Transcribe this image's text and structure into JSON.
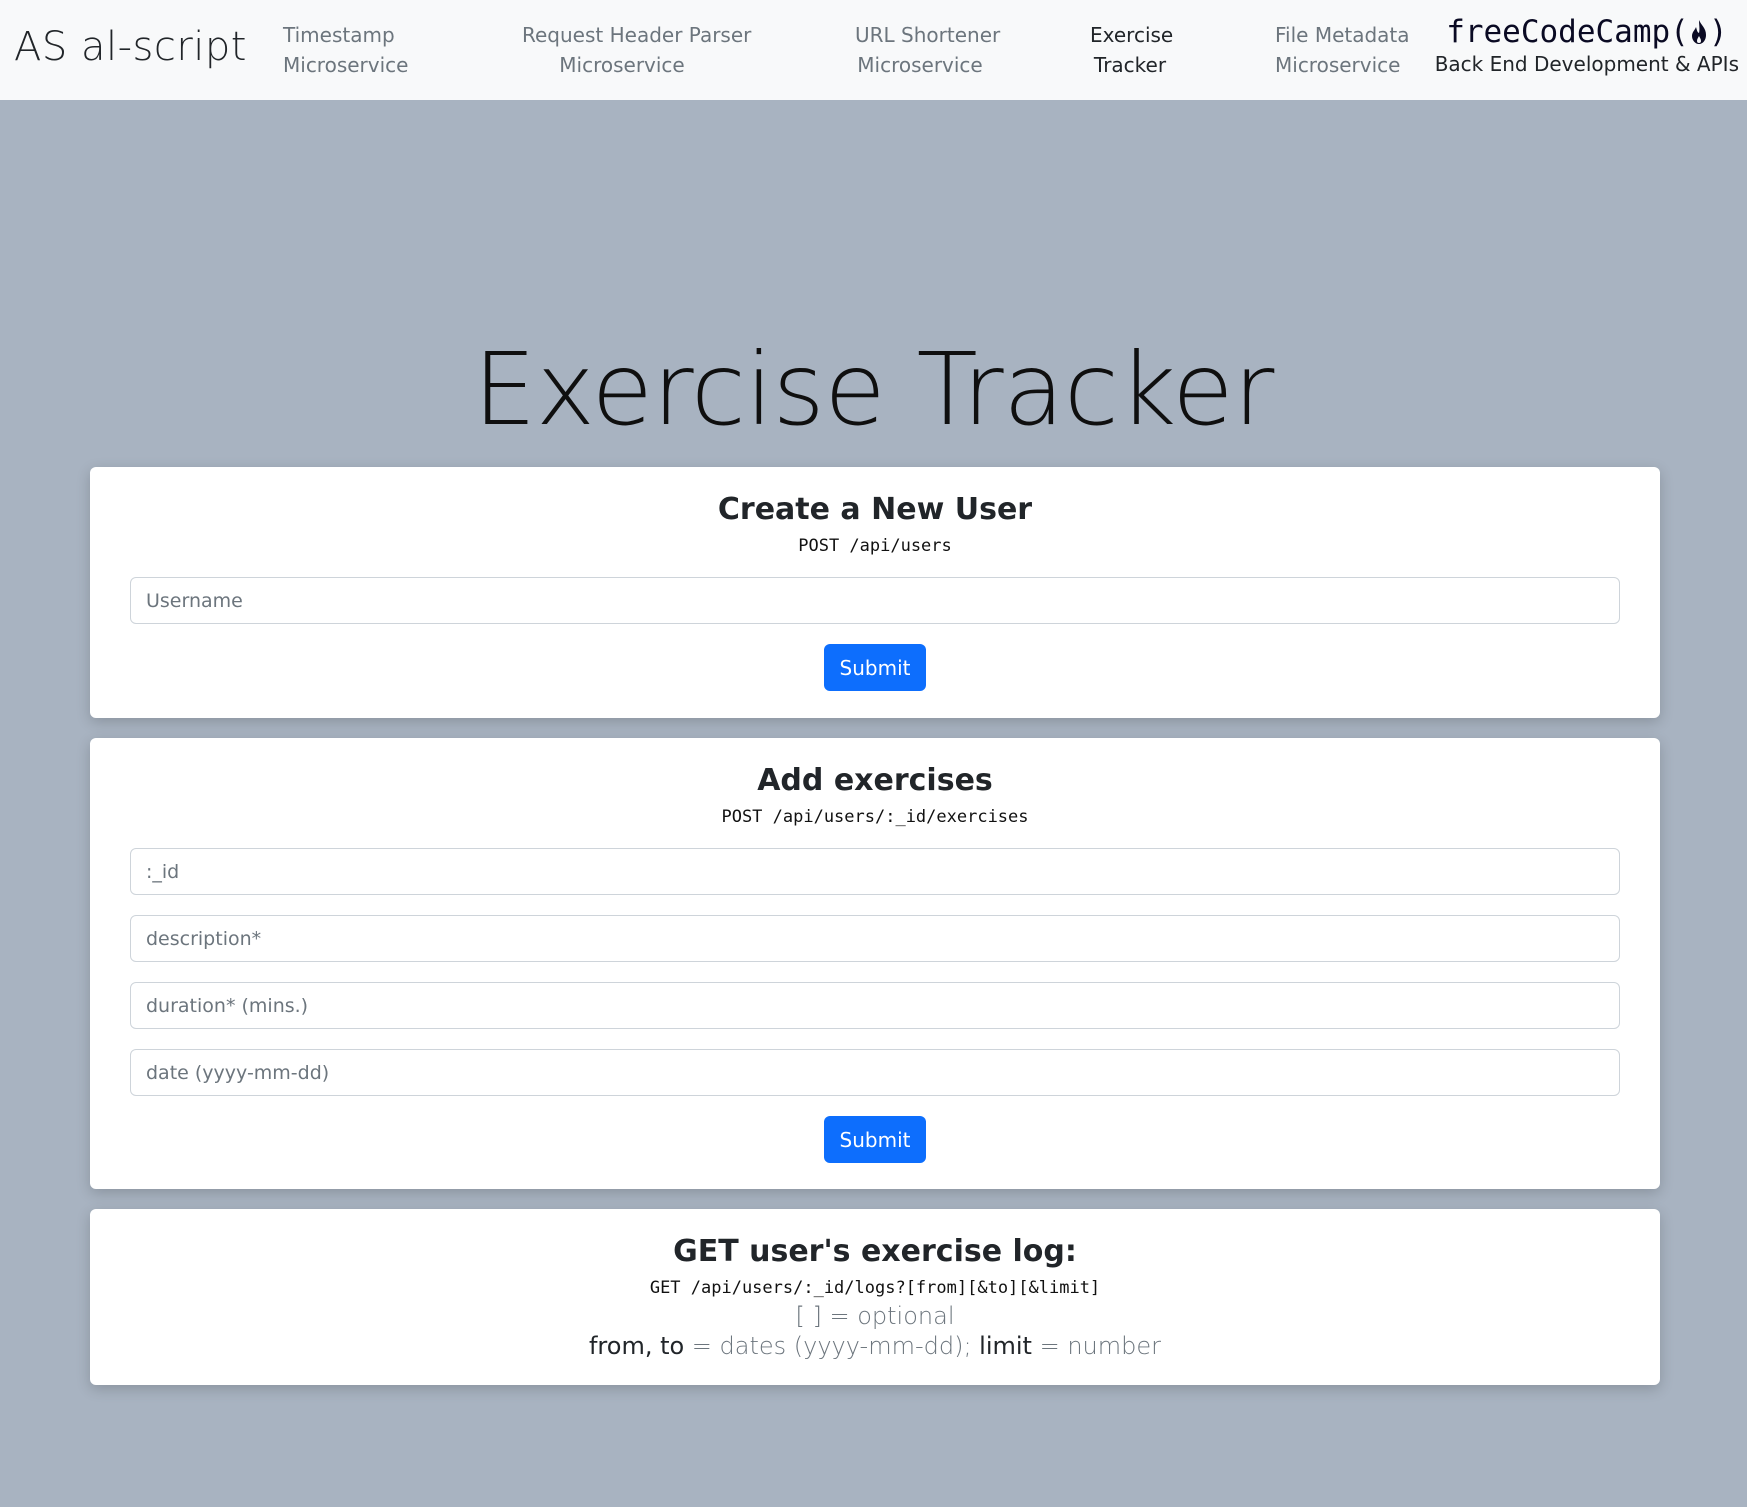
{
  "navbar": {
    "brand": "AS al-script",
    "items": [
      {
        "line1": "Timestamp",
        "line2": "Microservice",
        "active": false
      },
      {
        "line1": "Request Header Parser",
        "line2": "Microservice",
        "active": false
      },
      {
        "line1": "URL Shortener",
        "line2": "Microservice",
        "active": false
      },
      {
        "line1": "Exercise",
        "line2": "Tracker",
        "active": true
      },
      {
        "line1": "File Metadata",
        "line2": "Microservice",
        "active": false
      }
    ],
    "fcc_logo": {
      "text": "freeCodeCamp",
      "open_paren": "(",
      "close_paren": ")",
      "icon": "flame-icon"
    },
    "fcc_tagline": "Back End Development & APIs"
  },
  "page_title": "Exercise Tracker",
  "create_user": {
    "heading": "Create a New User",
    "endpoint": "POST /api/users",
    "username_placeholder": "Username",
    "submit_label": "Submit"
  },
  "add_exercises": {
    "heading": "Add exercises",
    "endpoint": "POST /api/users/:_id/exercises",
    "id_placeholder": ":_id",
    "description_placeholder": "description*",
    "duration_placeholder": "duration* (mins.)",
    "date_placeholder": "date (yyyy-mm-dd)",
    "submit_label": "Submit"
  },
  "get_log": {
    "heading": "GET user's exercise log:",
    "endpoint": "GET /api/users/:_id/logs?[from][&to][&limit]",
    "optional_note": "[ ] = optional",
    "from_to": "from, to",
    "eq1": " = dates (yyyy-mm-dd); ",
    "limit": "limit",
    "eq2": " = number"
  },
  "colors": {
    "background": "#a8b3c1",
    "navbar": "#f8f9fa",
    "primary_button": "#0d6efd",
    "muted_text": "#6c757d"
  }
}
